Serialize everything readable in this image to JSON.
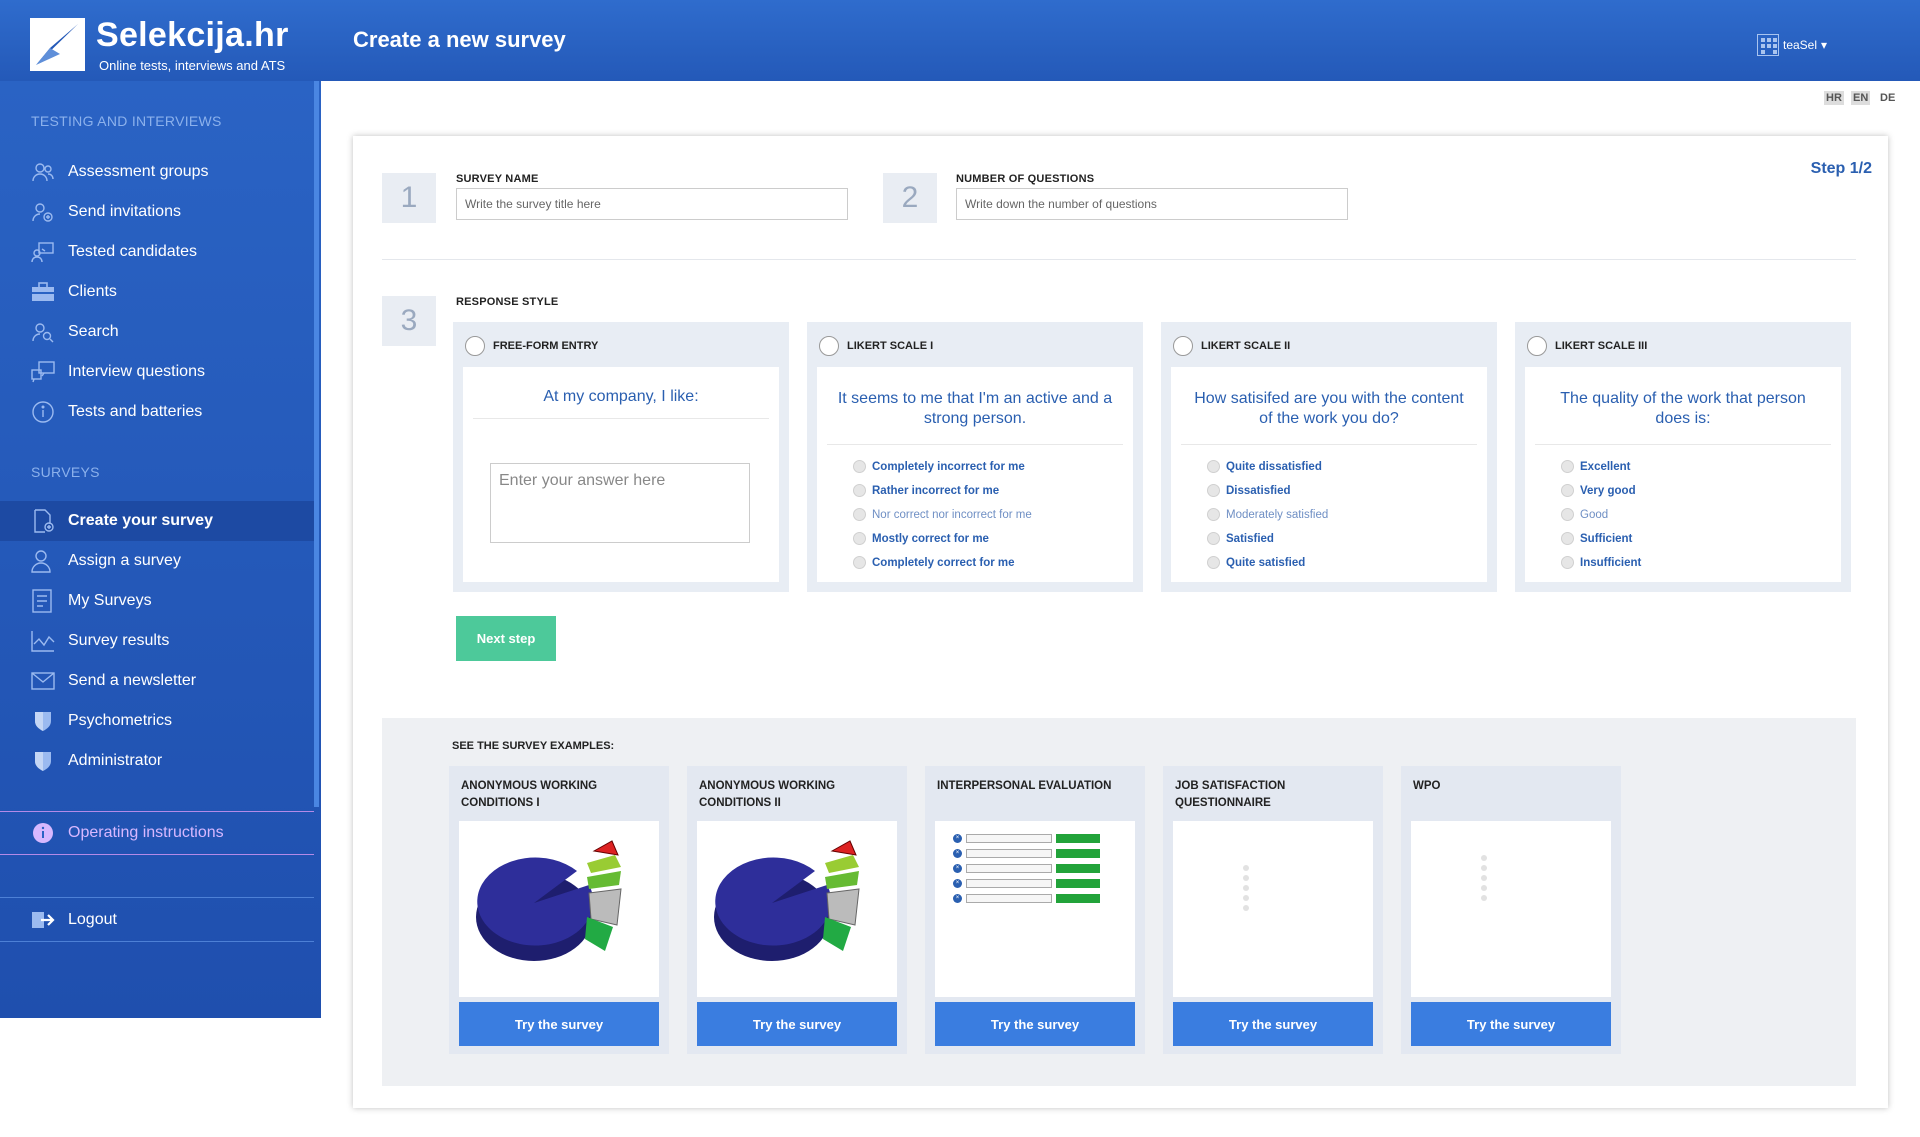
{
  "app": {
    "logo_title": "Selekcija.hr",
    "logo_subtitle": "Online tests, interviews and ATS",
    "page_title": "Create a new survey",
    "user": "teaSel",
    "user_caret": "▾"
  },
  "languages": [
    "HR",
    "EN",
    "DE"
  ],
  "sidebar": {
    "section_testing": "TESTING AND INTERVIEWS",
    "testing_items": [
      {
        "label": "Assessment groups",
        "icon": "people-icon"
      },
      {
        "label": "Send invitations",
        "icon": "person-add-icon"
      },
      {
        "label": "Tested candidates",
        "icon": "candidates-icon"
      },
      {
        "label": "Clients",
        "icon": "briefcase-icon"
      },
      {
        "label": "Search",
        "icon": "person-search-icon"
      },
      {
        "label": "Interview questions",
        "icon": "chat-question-icon"
      },
      {
        "label": "Tests and batteries",
        "icon": "info-icon"
      }
    ],
    "section_surveys": "SURVEYS",
    "survey_items": [
      {
        "label": "Create your survey",
        "icon": "document-add-icon"
      },
      {
        "label": "Assign a survey",
        "icon": "person-assign-icon"
      },
      {
        "label": "My Surveys",
        "icon": "list-icon"
      },
      {
        "label": "Survey results",
        "icon": "chart-icon"
      },
      {
        "label": "Send a newsletter",
        "icon": "envelope-icon"
      },
      {
        "label": "Psychometrics",
        "icon": "shield-icon"
      },
      {
        "label": "Administrator",
        "icon": "shield-icon"
      }
    ],
    "instructions": "Operating instructions",
    "logout": "Logout"
  },
  "form": {
    "step_indicator": "Step 1/2",
    "step1": "1",
    "step2": "2",
    "step3": "3",
    "survey_name_label": "SURVEY NAME",
    "survey_name_placeholder": "Write the survey title here",
    "num_questions_label": "NUMBER OF QUESTIONS",
    "num_questions_placeholder": "Write down the number of questions",
    "response_style_label": "RESPONSE STYLE",
    "styles": [
      {
        "title": "FREE-FORM ENTRY",
        "question": "At my company, I like:",
        "answer_placeholder": "Enter your answer here"
      },
      {
        "title": "LIKERT SCALE I",
        "question": "It seems to me that I'm an active and a strong person.",
        "options": [
          "Completely incorrect for me",
          "Rather incorrect for me",
          "Nor correct nor incorrect for me",
          "Mostly correct for me",
          "Completely correct for me"
        ]
      },
      {
        "title": "LIKERT SCALE II",
        "question": "How satisifed are you with the content of the work you do?",
        "options": [
          "Quite dissatisfied",
          "Dissatisfied",
          "Moderately satisfied",
          "Satisfied",
          "Quite satisfied"
        ]
      },
      {
        "title": "LIKERT SCALE III",
        "question": "The quality of the work that person does is:",
        "options": [
          "Excellent",
          "Very good",
          "Good",
          "Sufficient",
          "Insufficient"
        ]
      }
    ],
    "next_button": "Next step"
  },
  "examples": {
    "title": "SEE THE SURVEY EXAMPLES:",
    "try_label": "Try the survey",
    "items": [
      {
        "name": "ANONYMOUS WORKING CONDITIONS I"
      },
      {
        "name": "ANONYMOUS WORKING CONDITIONS II"
      },
      {
        "name": "INTERPERSONAL EVALUATION"
      },
      {
        "name": "JOB SATISFACTION QUESTIONNAIRE"
      },
      {
        "name": "WPO"
      }
    ]
  },
  "colors": {
    "brand_blue": "#2a63c4",
    "accent_green": "#4dc99a",
    "link_blue": "#2a5fb0",
    "button_blue": "#3a7de0"
  }
}
